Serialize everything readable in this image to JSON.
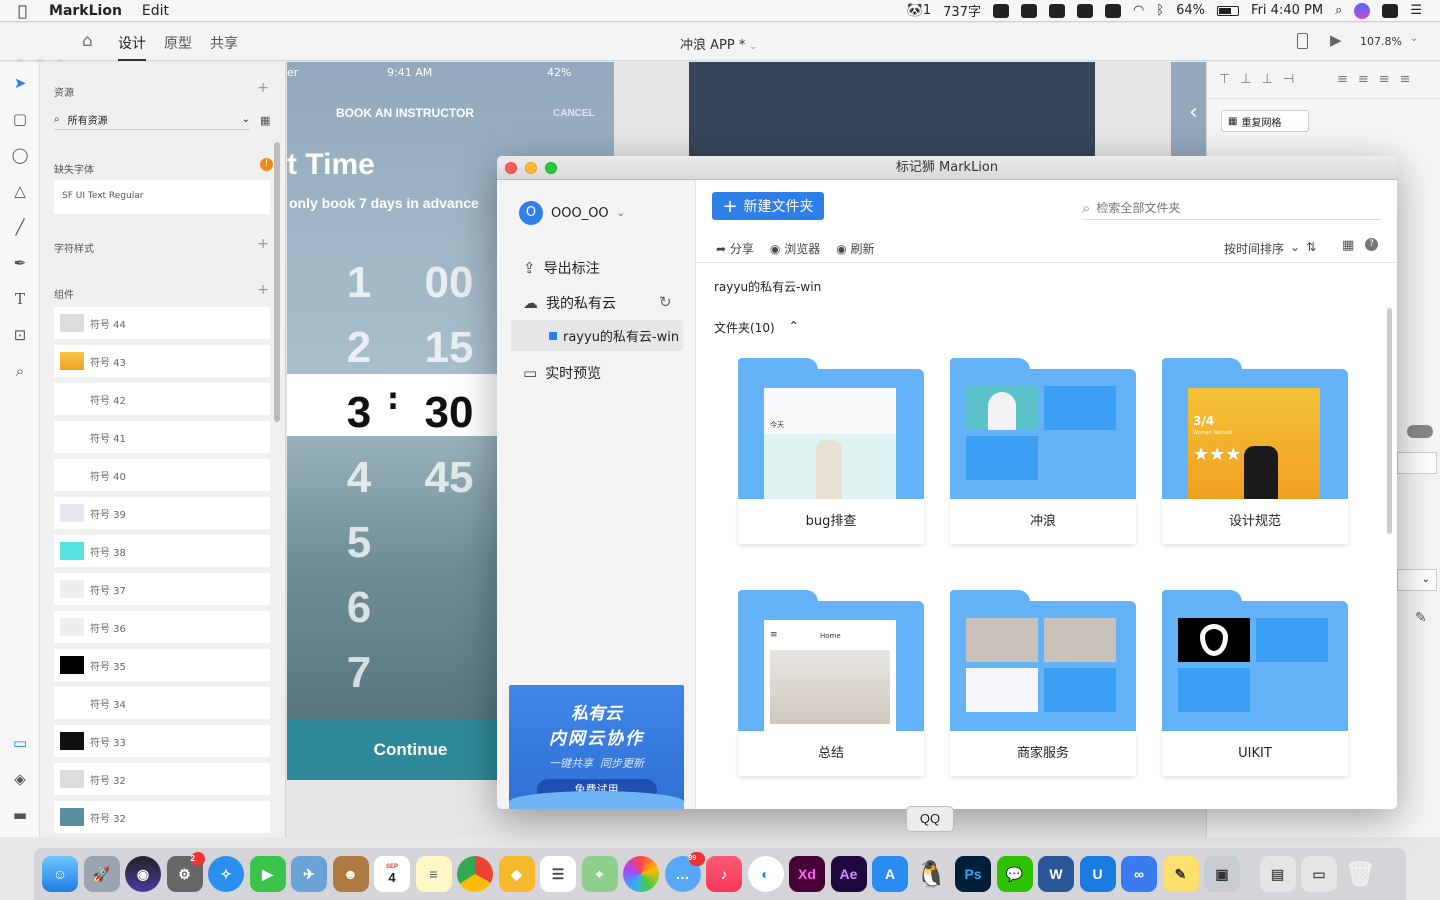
{
  "menubar": {
    "app": "MarkLion",
    "menu_edit": "Edit",
    "word_count": "737字",
    "battery": "64%",
    "clock": "Fri 4:40 PM"
  },
  "xd": {
    "tabs": [
      "设计",
      "原型",
      "共享"
    ],
    "doc_title": "冲浪 APP",
    "doc_modified": "*",
    "zoom": "107.8%",
    "assets_title": "资源",
    "search_placeholder": "所有资源",
    "missing_fonts": "缺失字体",
    "font_name": "SF UI Text Regular",
    "char_styles": "字符样式",
    "components": "组件",
    "symbols": [
      "符号 44",
      "符号 43",
      "符号 42",
      "符号 41",
      "符号 40",
      "符号 39",
      "符号 38",
      "符号 37",
      "符号 36",
      "符号 35",
      "符号 34",
      "符号 33",
      "符号 32",
      "符号 32"
    ],
    "repeat_grid": "重复网格"
  },
  "artboard": {
    "status_carrier": "er",
    "status_time": "9:41 AM",
    "status_battery": "42%",
    "header": "BOOK AN INSTRUCTOR",
    "cancel": "CANCEL",
    "title_frag": "t Time",
    "subtitle": "only book 7 days in advance",
    "hours": [
      "1",
      "2",
      "3",
      "4",
      "5",
      "6",
      "7"
    ],
    "minutes": [
      "00",
      "15",
      "30",
      "45"
    ],
    "colon": ":",
    "continue": "Continue"
  },
  "marklion": {
    "window_title": "标记狮 MarkLion",
    "user_initial": "O",
    "user_name": "OOO_OO",
    "nav_export": "导出标注",
    "nav_cloud": "我的私有云",
    "nav_cloud_sub": "rayyu的私有云-win",
    "nav_preview": "实时预览",
    "promo_line1": "私有云",
    "promo_line2": "内网云协作",
    "promo_line3a": "一键共享",
    "promo_line3b": "同步更新",
    "promo_btn": "免费试用",
    "new_folder_btn": "新建文件夹",
    "search_placeholder": "检索全部文件夹",
    "act_share": "分享",
    "act_browser": "浏览器",
    "act_refresh": "刷新",
    "sort_label": "按时间排序",
    "breadcrumb": "rayyu的私有云-win",
    "folder_count": "文件夹(10)",
    "folders": [
      "bug排查",
      "冲浪",
      "设计规范",
      "总结",
      "商家服务",
      "UIKIT"
    ],
    "thumb_text_home": "Home",
    "thumb_text_34": "3/4",
    "thumb_text_women": "Women Wetsuit",
    "thumb_text_today": "今天"
  },
  "dock": {
    "tooltip": "QQ",
    "calendar_month": "SEP",
    "calendar_day": "4",
    "badge_settings": "2",
    "badge_msg": "99"
  },
  "colors": {
    "accent": "#3a8ee6",
    "folder": "#64b2f7",
    "folder_dark": "#3a9ef3"
  }
}
